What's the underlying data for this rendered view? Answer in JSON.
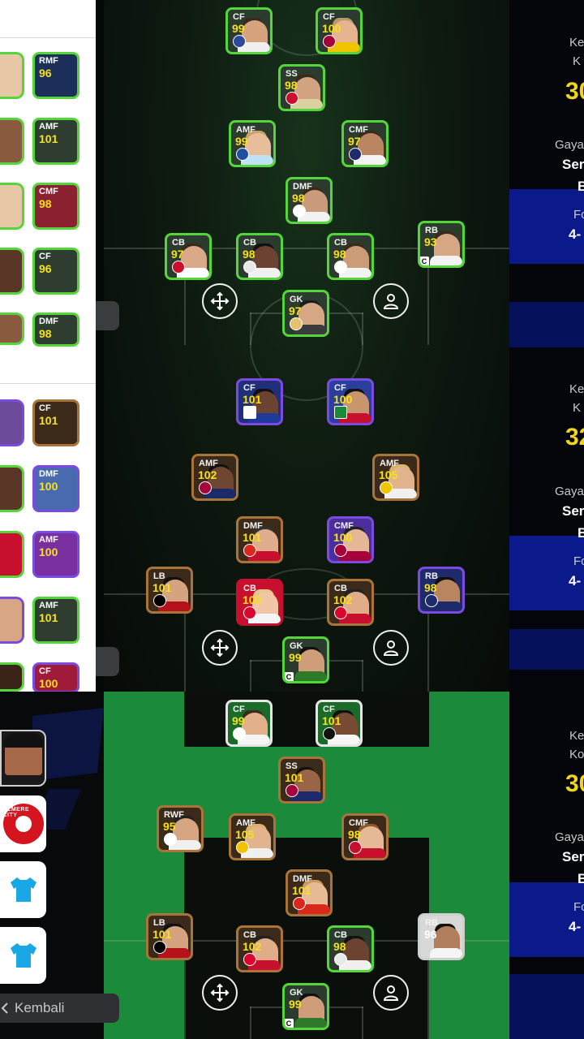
{
  "right_panel": {
    "sections": [
      {
        "label1": "Ke",
        "label2": "K",
        "value": "30",
        "gaya_label": "Gaya",
        "gaya_value": "Ser",
        "gaya_sub": "B",
        "formation_label": "Fo",
        "formation_value": "4-"
      },
      {
        "label1": "Ke",
        "label2": "K",
        "value": "32",
        "gaya_label": "Gaya",
        "gaya_value": "Ser",
        "gaya_sub": "B",
        "formation_label": "Fo",
        "formation_value": "4-"
      },
      {
        "label1": "Ke",
        "label2": "Ko",
        "value": "30",
        "gaya_label": "Gaya",
        "gaya_value": "Ser",
        "gaya_sub": "B",
        "formation_label": "Fo",
        "formation_value": "4-"
      }
    ]
  },
  "left_list": {
    "group1": [
      {
        "pos": "RMF",
        "rating": "96"
      },
      {
        "pos": "AMF",
        "rating": "101"
      },
      {
        "pos": "CMF",
        "rating": "98"
      },
      {
        "pos": "CF",
        "rating": "96"
      },
      {
        "pos": "DMF",
        "rating": "98"
      }
    ],
    "group2": [
      {
        "pos": "CF",
        "rating": "101"
      },
      {
        "pos": "DMF",
        "rating": "100"
      },
      {
        "pos": "AMF",
        "rating": "100"
      },
      {
        "pos": "AMF",
        "rating": "101"
      },
      {
        "pos": "CF",
        "rating": "100"
      }
    ]
  },
  "formations": [
    {
      "players": [
        {
          "pos": "CF",
          "rating": "99"
        },
        {
          "pos": "CF",
          "rating": "100"
        },
        {
          "pos": "SS",
          "rating": "98"
        },
        {
          "pos": "AMF",
          "rating": "99"
        },
        {
          "pos": "CMF",
          "rating": "97"
        },
        {
          "pos": "DMF",
          "rating": "98"
        },
        {
          "pos": "CB",
          "rating": "97"
        },
        {
          "pos": "CB",
          "rating": "98"
        },
        {
          "pos": "CB",
          "rating": "98"
        },
        {
          "pos": "RB",
          "rating": "93"
        },
        {
          "pos": "GK",
          "rating": "97"
        }
      ]
    },
    {
      "players": [
        {
          "pos": "CF",
          "rating": "101"
        },
        {
          "pos": "CF",
          "rating": "100"
        },
        {
          "pos": "AMF",
          "rating": "102"
        },
        {
          "pos": "AMF",
          "rating": "105"
        },
        {
          "pos": "DMF",
          "rating": "101"
        },
        {
          "pos": "CMF",
          "rating": "100"
        },
        {
          "pos": "LB",
          "rating": "101"
        },
        {
          "pos": "CB",
          "rating": "100"
        },
        {
          "pos": "CB",
          "rating": "102"
        },
        {
          "pos": "RB",
          "rating": "98"
        },
        {
          "pos": "GK",
          "rating": "99"
        }
      ]
    },
    {
      "players": [
        {
          "pos": "CF",
          "rating": "99"
        },
        {
          "pos": "CF",
          "rating": "101"
        },
        {
          "pos": "SS",
          "rating": "101"
        },
        {
          "pos": "RWF",
          "rating": "95"
        },
        {
          "pos": "AMF",
          "rating": "105"
        },
        {
          "pos": "CMF",
          "rating": "98"
        },
        {
          "pos": "DMF",
          "rating": "101"
        },
        {
          "pos": "LB",
          "rating": "101"
        },
        {
          "pos": "CB",
          "rating": "102"
        },
        {
          "pos": "CB",
          "rating": "98"
        },
        {
          "pos": "RB",
          "rating": "96"
        },
        {
          "pos": "GK",
          "rating": "99"
        }
      ]
    }
  ],
  "captain_mark": "C",
  "club_badge_text": "ALMERE CITY",
  "back_button": {
    "label": "Kembali"
  },
  "icons": {
    "move": "move-arrows-icon",
    "player": "person-icon",
    "back": "chevron-left-icon",
    "kit": "shirt-icon"
  },
  "colors": {
    "card_border_green": "#54d63a",
    "rating_yellow": "#f6e11c",
    "pitch_green": "#1b8a3a",
    "panel_blue": "#0a1a8a",
    "kit_blue": "#1aa7e6"
  }
}
